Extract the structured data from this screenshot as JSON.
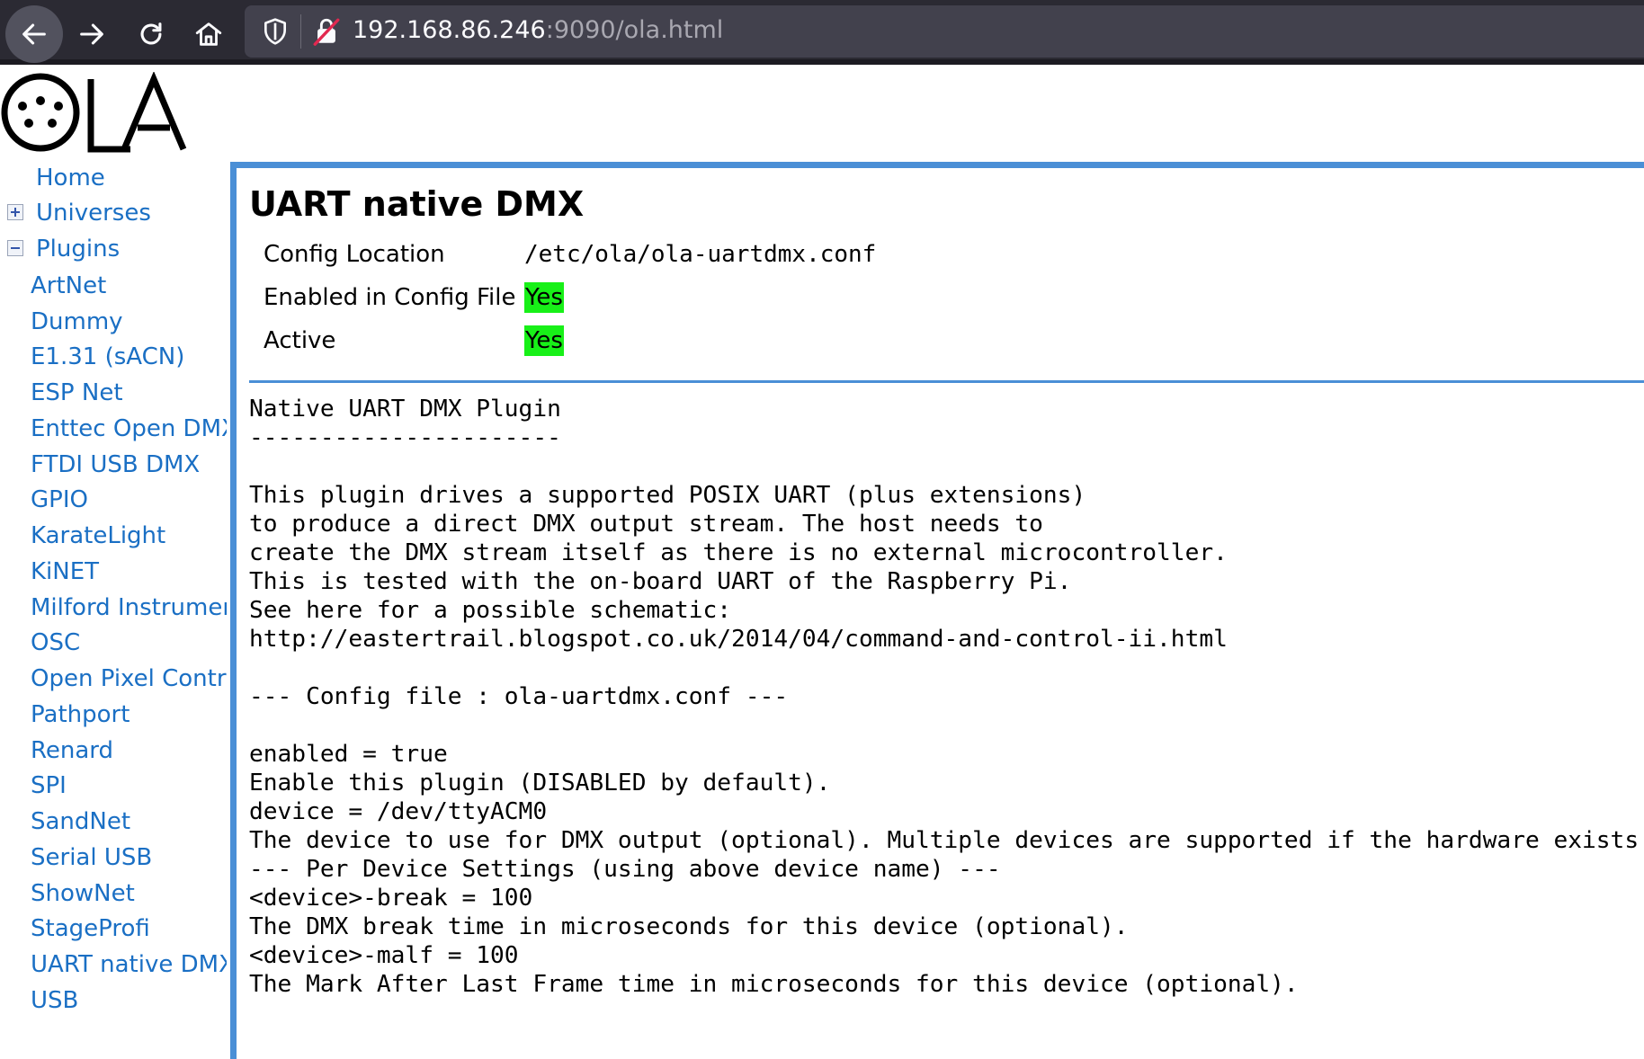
{
  "browser": {
    "url_host": "192.168.86.246",
    "url_rest": ":9090/ola.html",
    "back_icon": "arrow-left",
    "forward_icon": "arrow-right",
    "reload_icon": "reload",
    "home_icon": "home",
    "shield_icon": "shield",
    "insecure_icon": "insecure-lock"
  },
  "logo": {
    "text": "OLA"
  },
  "nav": {
    "home": "Home",
    "universes": "Universes",
    "plugins": "Plugins",
    "plugin_items": [
      "ArtNet",
      "Dummy",
      "E1.31 (sACN)",
      "ESP Net",
      "Enttec Open DMX",
      "FTDI USB DMX",
      "GPIO",
      "KarateLight",
      "KiNET",
      "Milford Instruments",
      "OSC",
      "Open Pixel Control",
      "Pathport",
      "Renard",
      "SPI",
      "SandNet",
      "Serial USB",
      "ShowNet",
      "StageProfi",
      "UART native DMX",
      "USB"
    ]
  },
  "plugin": {
    "title": "UART native DMX",
    "config_location_label": "Config Location",
    "config_location_value": "/etc/ola/ola-uartdmx.conf",
    "enabled_label": "Enabled in Config File",
    "enabled_value": "Yes",
    "active_label": "Active",
    "active_value": "Yes",
    "status_color": "#18f018",
    "description": "Native UART DMX Plugin\n----------------------\n\nThis plugin drives a supported POSIX UART (plus extensions)\nto produce a direct DMX output stream. The host needs to\ncreate the DMX stream itself as there is no external microcontroller.\nThis is tested with the on-board UART of the Raspberry Pi.\nSee here for a possible schematic:\nhttp://eastertrail.blogspot.co.uk/2014/04/command-and-control-ii.html\n\n--- Config file : ola-uartdmx.conf ---\n\nenabled = true\nEnable this plugin (DISABLED by default).\ndevice = /dev/ttyACM0\nThe device to use for DMX output (optional). Multiple devices are supported if the hardware exists.\n--- Per Device Settings (using above device name) ---\n<device>-break = 100\nThe DMX break time in microseconds for this device (optional).\n<device>-malf = 100\nThe Mark After Last Frame time in microseconds for this device (optional)."
  }
}
